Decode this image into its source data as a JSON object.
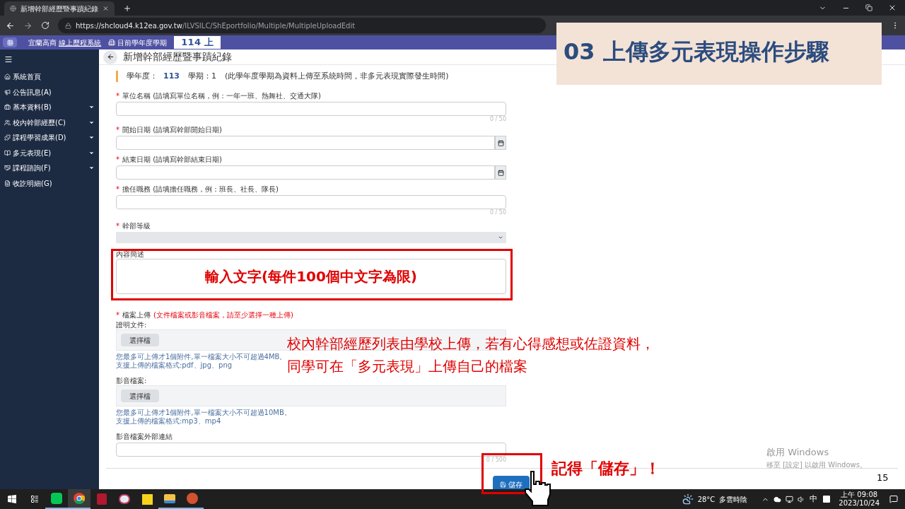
{
  "browser": {
    "tab_title": "新增幹部經歷暨事蹟紀錄",
    "url_host": "https://shcloud4.k12ea.gov.tw",
    "url_path": "/ILVSILC/ShEportfolio/Multiple/MultipleUploadEdit"
  },
  "app_header": {
    "school": "宜蘭高商",
    "system_name": "線上歷程系統",
    "term_label": "目前學年度學期",
    "term_value": "114 上"
  },
  "sidebar": {
    "items": [
      {
        "label": "系統首頁",
        "has_submenu": false
      },
      {
        "label": "公告訊息(A)",
        "has_submenu": false
      },
      {
        "label": "基本資料(B)",
        "has_submenu": true
      },
      {
        "label": "校內幹部經歷(C)",
        "has_submenu": true
      },
      {
        "label": "課程學習成果(D)",
        "has_submenu": true
      },
      {
        "label": "多元表現(E)",
        "has_submenu": true
      },
      {
        "label": "課程諮詢(F)",
        "has_submenu": true
      },
      {
        "label": "收訖明細(G)",
        "has_submenu": false
      }
    ]
  },
  "page": {
    "title": "新增幹部經歷暨事蹟紀錄",
    "required_mark": "*",
    "term_info": {
      "year_label": "學年度：",
      "year": "113",
      "semester": "學期：1",
      "note": "(此學年度學期為資料上傳至系統時間，非多元表現實際發生時間)"
    },
    "fields": [
      {
        "kind": "text",
        "required": true,
        "label": "單位名稱",
        "hint": "(請填寫單位名稱，例：一年一班、熱舞社、交通大隊)",
        "counter": "0 / 50"
      },
      {
        "kind": "date",
        "required": true,
        "label": "開始日期",
        "hint": "(請填寫幹部開始日期)"
      },
      {
        "kind": "date",
        "required": true,
        "label": "結束日期",
        "hint": "(請填寫幹部結束日期)"
      },
      {
        "kind": "text",
        "required": true,
        "label": "擔任職務",
        "hint": "(請填擔任職務，例：班長、社長、隊長)",
        "counter": "0 / 50"
      },
      {
        "kind": "select",
        "required": true,
        "label": "幹部等級"
      },
      {
        "kind": "textarea",
        "required": false,
        "label": "內容簡述"
      },
      {
        "kind": "upload",
        "required": true,
        "label": "檔案上傳",
        "hint": "(文件檔案或影音檔案，請至少選擇一種上傳)",
        "groups": [
          {
            "label": "證明文件:",
            "button": "選擇檔",
            "help": [
              "您最多可上傳才1個附件,單一檔案大小不可超過4MB。",
              "支援上傳的檔案格式:pdf、jpg、png"
            ]
          },
          {
            "label": "影音檔案:",
            "button": "選擇檔",
            "help": [
              "您最多可上傳才1個附件,單一檔案大小不可超過10MB。",
              "支援上傳的檔案格式:mp3、mp4"
            ]
          }
        ]
      },
      {
        "kind": "text",
        "required": false,
        "label": "影音檔案外部連結",
        "counter": "0 / 500"
      }
    ],
    "save_button": "儲存"
  },
  "annotations": {
    "slide_title": "03 上傳多元表現操作步驟",
    "textarea_note": "輸入文字(每件100個中文字為限)",
    "upload_note": [
      "校內幹部經歷列表由學校上傳，若有心得感想或佐證資料，",
      "同學可在「多元表現」上傳自己的檔案"
    ],
    "save_note": "記得「儲存」！",
    "slide_number": "15"
  },
  "activation": {
    "title": "啟用 Windows",
    "subtitle": "移至 [設定] 以啟用 Windows。"
  },
  "taskbar": {
    "apps": [
      {
        "running": true,
        "selected": false
      },
      {
        "running": true,
        "selected": true
      },
      {
        "running": false,
        "selected": false
      },
      {
        "running": false,
        "selected": false
      },
      {
        "running": false,
        "selected": false
      },
      {
        "running": true,
        "selected": false
      },
      {
        "running": true,
        "selected": false
      }
    ],
    "temperature": "28°C",
    "weather": "多雲時陰",
    "ime": "中",
    "time": "上午 09:08",
    "date": "2023/10/24"
  }
}
